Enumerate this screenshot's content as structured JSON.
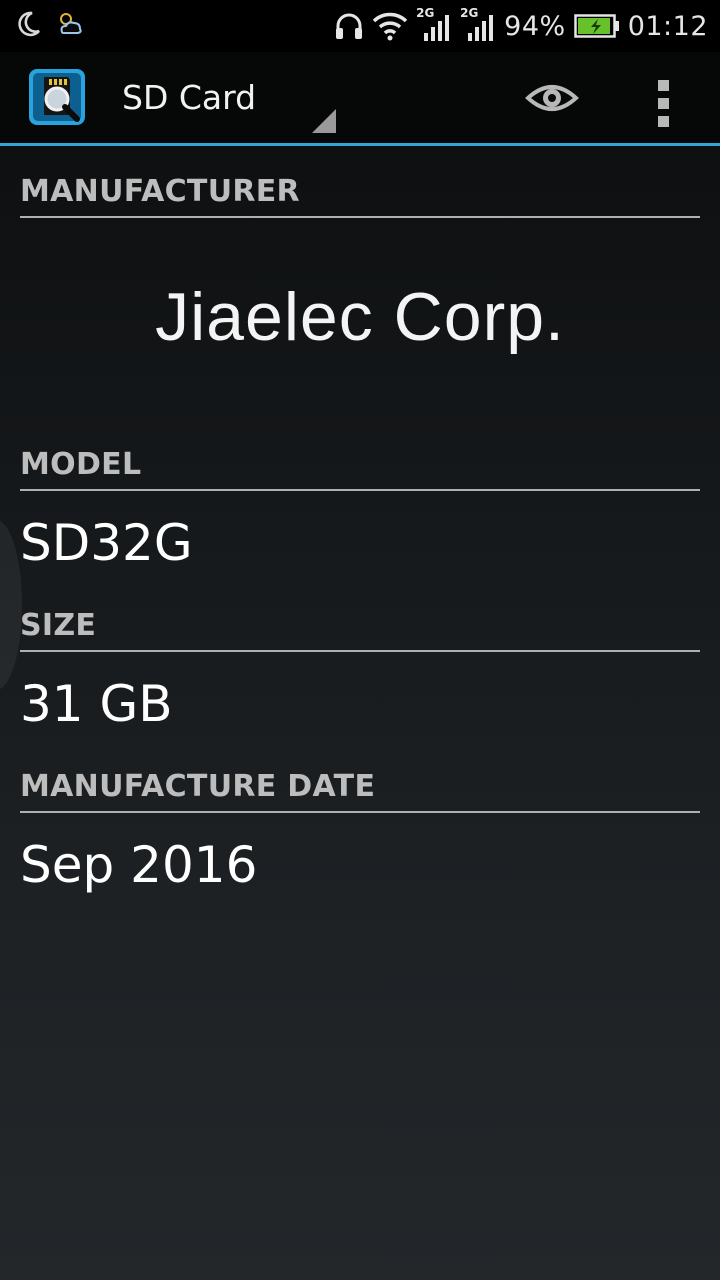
{
  "status_bar": {
    "battery_percent": "94%",
    "time": "01:12",
    "signal_1_tag": "2G",
    "signal_2_tag": "2G",
    "battery_level": 0.94,
    "icons": [
      "moon-icon",
      "weather-icon",
      "headphones-icon",
      "wifi-icon",
      "signal-icon",
      "battery-charging-icon"
    ]
  },
  "action_bar": {
    "title": "SD Card",
    "icons": [
      "sd-card-search-app-icon",
      "eye-icon",
      "overflow-menu-icon"
    ],
    "accent_color": "#33a5d6"
  },
  "sections": [
    {
      "header": "MANUFACTURER",
      "value": "Jiaelec Corp."
    },
    {
      "header": "MODEL",
      "value": "SD32G"
    },
    {
      "header": "SIZE",
      "value": "31 GB"
    },
    {
      "header": "MANUFACTURE DATE",
      "value": "Sep 2016"
    }
  ]
}
